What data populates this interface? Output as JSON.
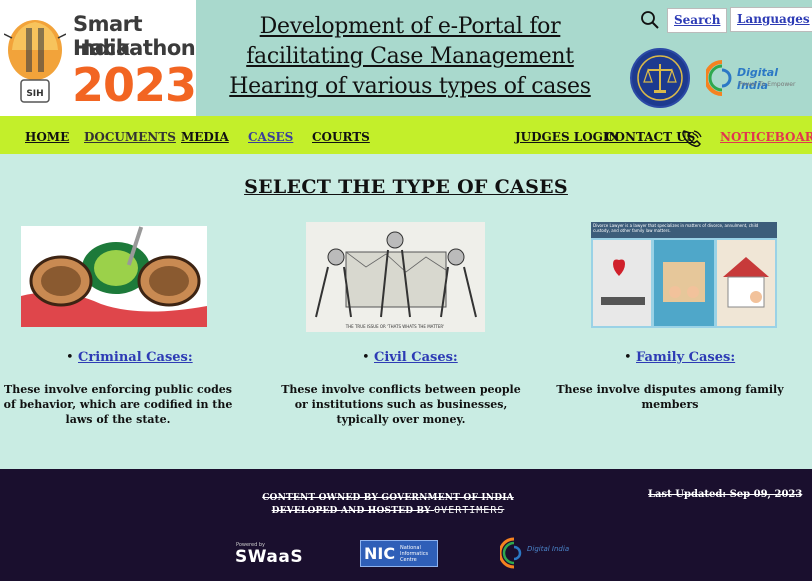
{
  "header": {
    "logo": {
      "line1": "Smart India",
      "line2": "Hackathon",
      "year": "2023",
      "badge": "SIH"
    },
    "title": "Development of e-Portal for facilitating Case Management Hearing of various types of cases",
    "search_label": "Search",
    "languages_label": "Languages",
    "digital_india": "Digital India",
    "digital_india_tagline": "Power To Empower"
  },
  "nav": {
    "home": "HOME",
    "documents": "DOCUMENTS",
    "media": "MEDIA",
    "cases": "CASES",
    "courts": "COURTS",
    "judges_login": "JUDGES LOGIN",
    "contact_us": "CONTACT US",
    "noticeboard": "NOTICEBOARD"
  },
  "main": {
    "section_title": "SELECT THE TYPE OF CASES",
    "cases": [
      {
        "title": "Criminal Cases:",
        "description": "These involve enforcing public codes of behavior, which are codified in the laws of the state."
      },
      {
        "title": "Civil Cases:",
        "description": "These involve conflicts between people or institutions such as businesses, typically over money.",
        "image_caption": "THE TRUE ISSUE OR 'THATS WHATS THE MATTER'"
      },
      {
        "title": "Family Cases:",
        "description": "These involve disputes among family members",
        "image_caption": "Divorce Lawyer is a lawyer that specializes in matters of divorce, annulment, child custody, and other family law matters."
      }
    ]
  },
  "footer": {
    "owned": "CONTENT OWNED BY GOVERNMENT OF INDIA",
    "developed_prefix": "DEVELOPED AND HOSTED BY",
    "developed_by": "OVERTIMERS",
    "last_updated": "Last Updated: Sep 09, 2023",
    "swaas_small": "Powered by",
    "swaas": "SWaaS",
    "nic": "NIC",
    "nic_full": "National Informatics Centre",
    "digital_india": "Digital India"
  }
}
